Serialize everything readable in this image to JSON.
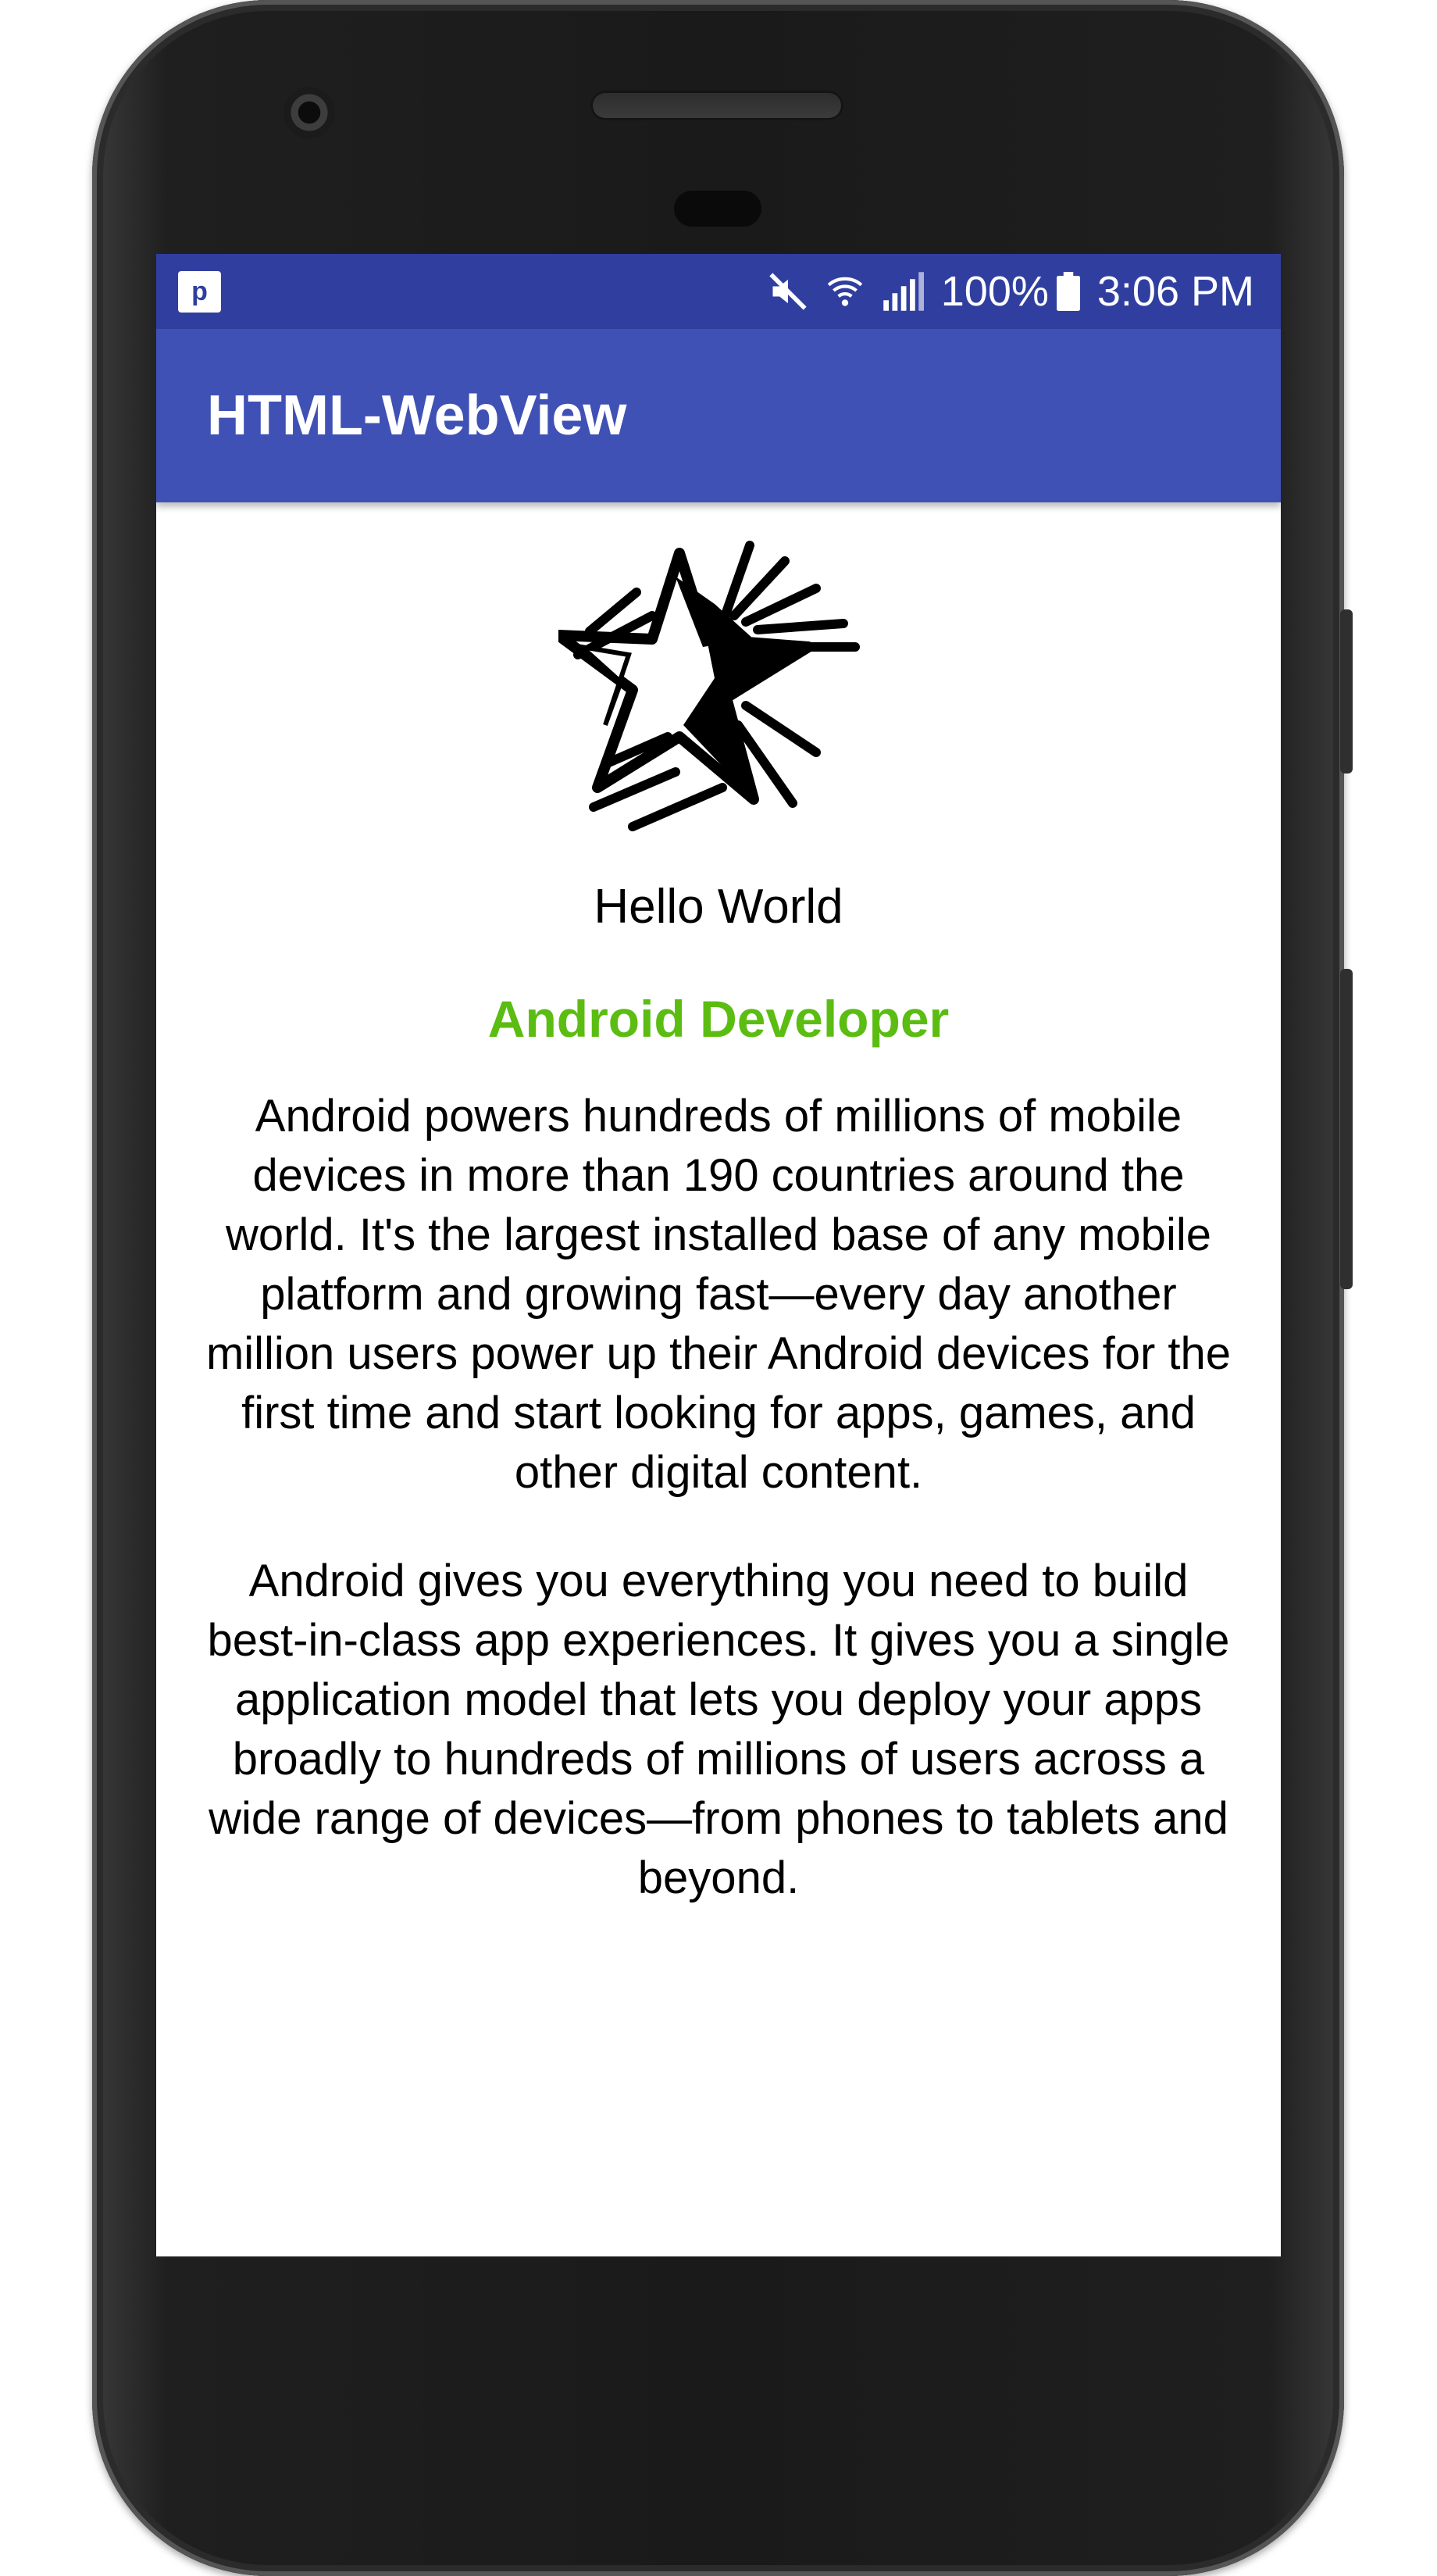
{
  "status_bar": {
    "app_icon": "p",
    "icons": [
      "mute-icon",
      "wifi-icon",
      "signal-icon"
    ],
    "battery": "100%",
    "time": "3:06 PM"
  },
  "app_bar": {
    "title": "HTML-WebView"
  },
  "content": {
    "logo": "star-logo",
    "hello": "Hello World",
    "heading": "Android Developer",
    "heading_color": "#5bbd12",
    "paragraph1": "Android powers hundreds of millions of mobile devices in more than 190 countries around the world. It's the largest installed base of any mobile platform and growing fast—every day another million users power up their Android devices for the first time and start looking for apps, games, and other digital content.",
    "paragraph2": "Android gives you everything you need to build best-in-class app experiences. It gives you a single application model that lets you deploy your apps broadly to hundreds of millions of users across a wide range of devices—from phones to tablets and beyond."
  },
  "colors": {
    "status_bar": "#303f9f",
    "app_bar": "#3f51b5"
  }
}
